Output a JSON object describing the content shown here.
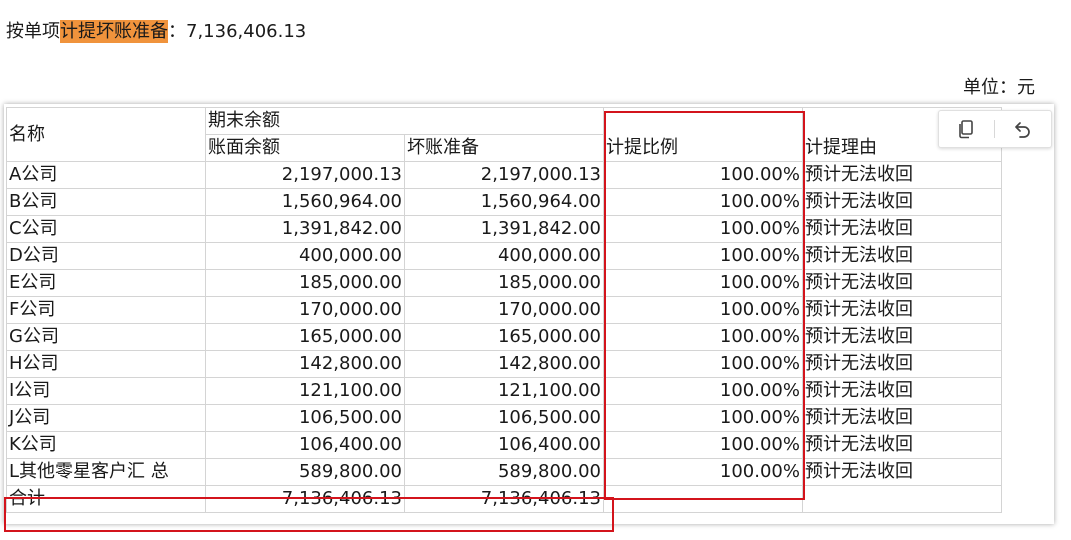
{
  "heading": {
    "prefix": "按单项",
    "highlight": "计提坏账准备",
    "separator": "：",
    "amount": "7,136,406.13"
  },
  "unit_label": "单位：元",
  "table": {
    "header": {
      "name": "名称",
      "group": "期末余额",
      "book_balance": "账面余额",
      "bad_debt": "坏账准备",
      "ratio": "计提比例",
      "reason": "计提理由"
    },
    "rows": [
      {
        "name": "A公司",
        "book": "2,197,000.13",
        "reserve": "2,197,000.13",
        "ratio": "100.00%",
        "reason": "预计无法收回"
      },
      {
        "name": "B公司",
        "book": "1,560,964.00",
        "reserve": "1,560,964.00",
        "ratio": "100.00%",
        "reason": "预计无法收回"
      },
      {
        "name": "C公司",
        "book": "1,391,842.00",
        "reserve": "1,391,842.00",
        "ratio": "100.00%",
        "reason": "预计无法收回"
      },
      {
        "name": "D公司",
        "book": "400,000.00",
        "reserve": "400,000.00",
        "ratio": "100.00%",
        "reason": "预计无法收回"
      },
      {
        "name": "E公司",
        "book": "185,000.00",
        "reserve": "185,000.00",
        "ratio": "100.00%",
        "reason": "预计无法收回"
      },
      {
        "name": "F公司",
        "book": "170,000.00",
        "reserve": "170,000.00",
        "ratio": "100.00%",
        "reason": "预计无法收回"
      },
      {
        "name": "G公司",
        "book": "165,000.00",
        "reserve": "165,000.00",
        "ratio": "100.00%",
        "reason": "预计无法收回"
      },
      {
        "name": "H公司",
        "book": "142,800.00",
        "reserve": "142,800.00",
        "ratio": "100.00%",
        "reason": "预计无法收回"
      },
      {
        "name": "I公司",
        "book": "121,100.00",
        "reserve": "121,100.00",
        "ratio": "100.00%",
        "reason": "预计无法收回"
      },
      {
        "name": "J公司",
        "book": "106,500.00",
        "reserve": "106,500.00",
        "ratio": "100.00%",
        "reason": "预计无法收回"
      },
      {
        "name": "K公司",
        "book": "106,400.00",
        "reserve": "106,400.00",
        "ratio": "100.00%",
        "reason": "预计无法收回"
      },
      {
        "name": "L其他零星客户汇 总",
        "book": "589,800.00",
        "reserve": "589,800.00",
        "ratio": "100.00%",
        "reason": "预计无法收回"
      }
    ],
    "total": {
      "name": "合计",
      "book": "7,136,406.13",
      "reserve": "7,136,406.13"
    }
  },
  "toolbar": {
    "copy_icon": "copy-icon",
    "undo_icon": "undo-icon"
  },
  "colors": {
    "highlight": "#f0933c",
    "annotation_red": "#d3141c",
    "grid_line": "#d4d4d4"
  }
}
